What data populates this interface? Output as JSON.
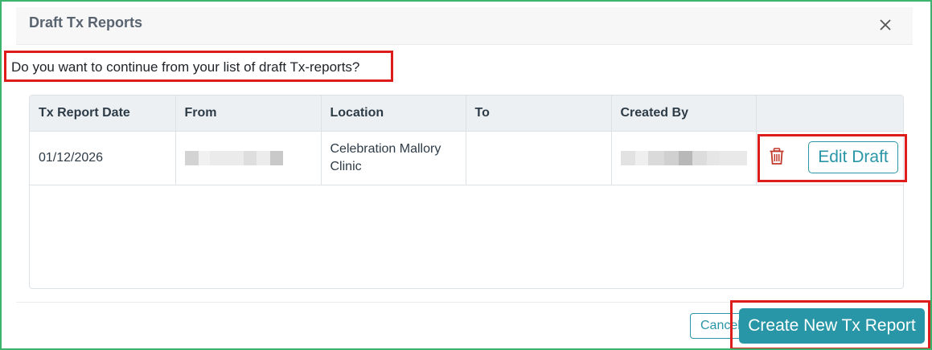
{
  "dialog": {
    "title": "Draft Tx Reports",
    "close_icon": "close-icon",
    "question": "Do you want to continue from your list of draft Tx-reports?"
  },
  "table": {
    "columns": [
      "Tx Report Date",
      "From",
      "Location",
      "To",
      "Created By",
      ""
    ],
    "rows": [
      {
        "date": "01/12/2026",
        "from": "",
        "location": "Celebration Mallory Clinic",
        "to": "",
        "created_by": "",
        "delete_icon": "trash-icon",
        "edit_label": "Edit Draft"
      }
    ]
  },
  "footer": {
    "cancel_label": "Cancel",
    "create_label": "Create New Tx Report"
  },
  "colors": {
    "accent": "#2896a6",
    "highlight": "#dd1c1c",
    "frame": "#3cb46e",
    "delete": "#c0392b"
  }
}
